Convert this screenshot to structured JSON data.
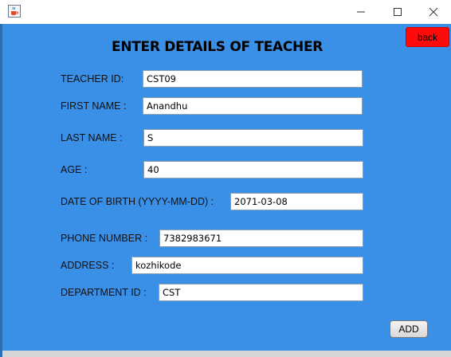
{
  "window": {
    "minimize_icon": "minimize-icon",
    "maximize_icon": "maximize-icon",
    "close_icon": "close-icon",
    "app_icon": "java-cup-icon"
  },
  "form": {
    "title": "ENTER DETAILS OF TEACHER",
    "back_label": "back",
    "add_label": "ADD",
    "fields": {
      "teacher_id": {
        "label": "TEACHER ID:",
        "value": "CST09"
      },
      "first_name": {
        "label": "FIRST NAME :",
        "value": "Anandhu"
      },
      "last_name": {
        "label": "LAST NAME :",
        "value": "S"
      },
      "age": {
        "label": "AGE :",
        "value": "40"
      },
      "dob": {
        "label": "DATE OF BIRTH (YYYY-MM-DD) :",
        "value": "2071-03-08"
      },
      "phone": {
        "label": "PHONE NUMBER :",
        "value": "7382983671"
      },
      "address": {
        "label": "ADDRESS :",
        "value": "kozhikode"
      },
      "department_id": {
        "label": "DEPARTMENT ID :",
        "value": "CST"
      }
    }
  },
  "colors": {
    "background": "#3a8fe6",
    "back_button": "#ff0a0a"
  }
}
